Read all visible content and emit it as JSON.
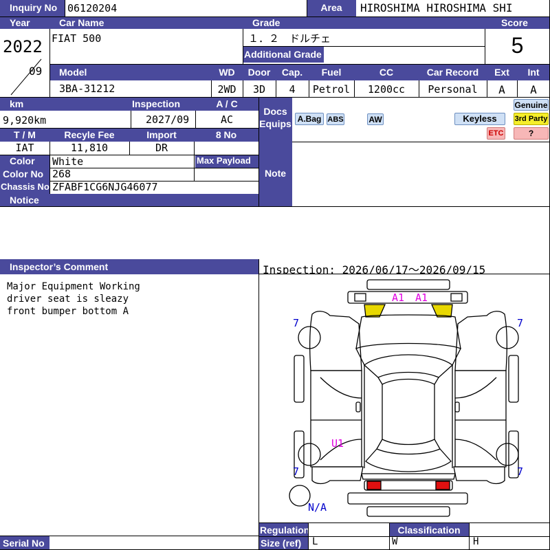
{
  "inquiry": {
    "label": "Inquiry No",
    "value": "06120204"
  },
  "area": {
    "label": "Area",
    "value": "HIROSHIMA HIROSHIMA SHI"
  },
  "year": {
    "label": "Year",
    "value": "2022",
    "month": "09"
  },
  "car_name": {
    "label": "Car Name",
    "value": "FIAT 500"
  },
  "grade": {
    "label": "Grade",
    "value": "１．２　ドルチェ",
    "additional_label": "Additional Grade",
    "additional_value": ""
  },
  "score": {
    "label": "Score",
    "value": "5"
  },
  "specs": {
    "model_label": "Model",
    "model": "3BA-31212",
    "wd_label": "WD",
    "wd": "2WD",
    "door_label": "Door",
    "door": "3D",
    "cap_label": "Cap.",
    "cap": "4",
    "fuel_label": "Fuel",
    "fuel": "Petrol",
    "cc_label": "CC",
    "cc": "1200cc",
    "record_label": "Car Record",
    "record": "Personal",
    "ext_label": "Ext",
    "ext": "A",
    "int_label": "Int",
    "int": "A"
  },
  "km": {
    "label": "km",
    "value": "9,920km"
  },
  "inspection": {
    "label": "Inspection",
    "value": "2027/09"
  },
  "ac": {
    "label": "A / C",
    "value": "AC"
  },
  "docs_equips": {
    "label_line1": "Docs",
    "label_line2": "Equips"
  },
  "equipment": {
    "abag": "A.Bag",
    "abs": "ABS",
    "aw": "AW",
    "keyless": "Keyless",
    "genuine": "Genuine",
    "third_party": "3rd Party",
    "etc": "ETC",
    "unknown": "?"
  },
  "transmission": {
    "label": "T / M",
    "value": "IAT"
  },
  "recycle_fee": {
    "label": "Recyle Fee",
    "value": "11,810"
  },
  "import": {
    "label": "Import",
    "value": "DR"
  },
  "eight_no": {
    "label": "8 No",
    "value": ""
  },
  "color": {
    "label": "Color",
    "value": "White"
  },
  "max_payload": {
    "label": "Max Payload",
    "value": ""
  },
  "color_no": {
    "label": "Color No",
    "value": "268"
  },
  "chassis_no": {
    "label": "Chassis No",
    "value": "ZFABF1CG6NJG46077"
  },
  "note": {
    "label": "Note"
  },
  "notice": {
    "label": "Notice"
  },
  "inspector_comment": {
    "label": "Inspector’s Comment",
    "text": "Major Equipment Working\ndriver seat is sleazy\nfront bumper bottom A"
  },
  "inspection_period": "Inspection: 2026/06/17〜2026/09/15",
  "diagram": {
    "marks": {
      "a1_left": "A1",
      "a1_right": "A1",
      "u1": "U1"
    },
    "tire_tl": "7",
    "tire_tr": "7",
    "tire_bl": "7",
    "tire_br": "7",
    "spare": "N/A"
  },
  "regulation": {
    "label": "Regulation"
  },
  "size": {
    "label": "Size (ref)",
    "l": "L",
    "w": "W",
    "h": "H"
  },
  "classification": {
    "label": "Classification"
  },
  "serial_no": {
    "label": "Serial No"
  },
  "colors": {
    "header": "#4a4a9c",
    "marks": "#e000e0",
    "tires": "#0000cc",
    "yellow_mark": "#e8d800",
    "red_lamp": "#e01010"
  }
}
